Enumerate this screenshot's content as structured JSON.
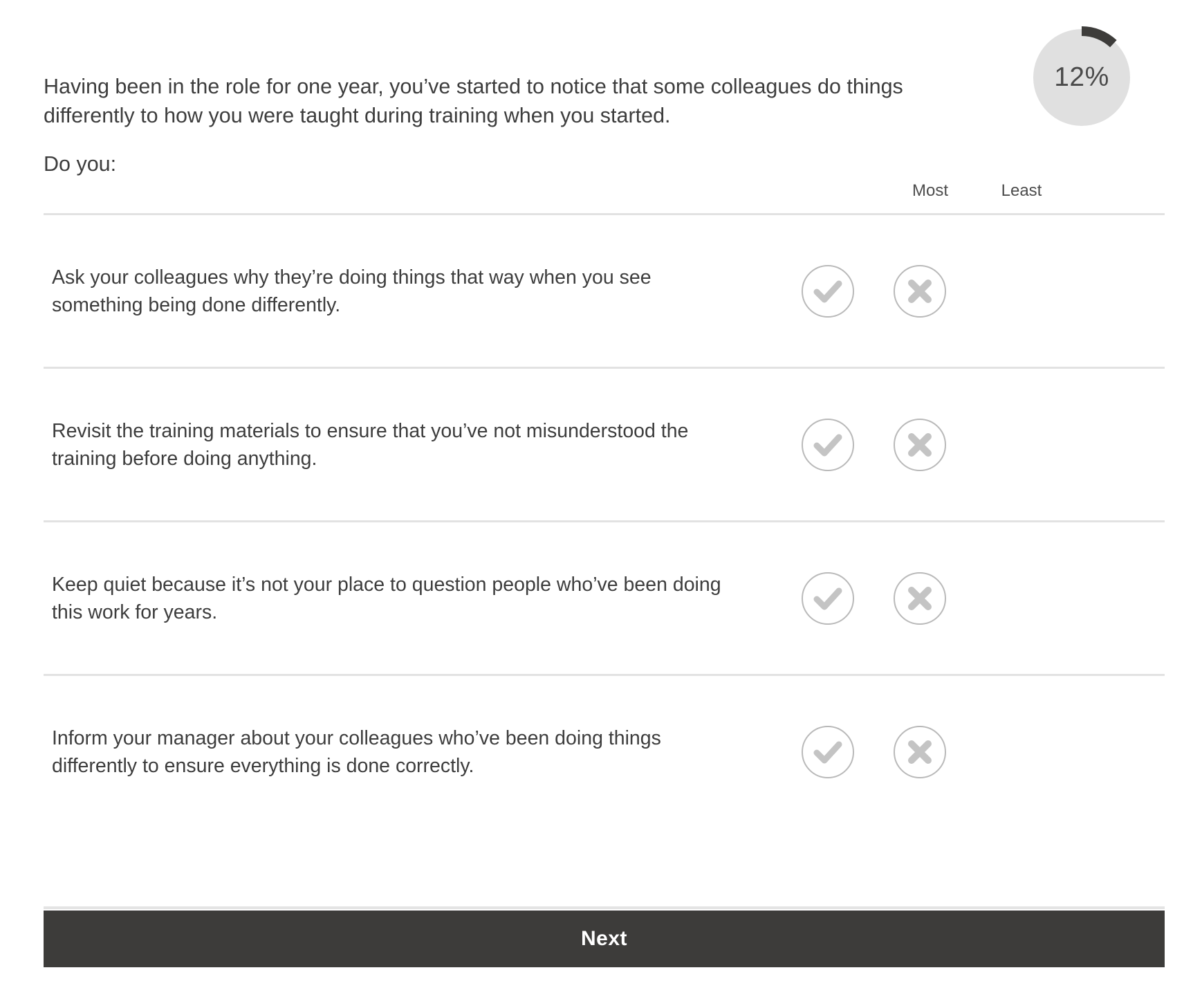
{
  "progress": {
    "percent_label": "12%",
    "percent_value": 12,
    "track_color": "#e0e0e0",
    "arc_color": "#3d3c3a"
  },
  "question": {
    "stem_line_1": "Having been in the role for one year, you’ve started to notice that some colleagues do things",
    "stem_line_2": "differently to how you were taught during training when you started.",
    "prompt": "Do you:"
  },
  "columns": {
    "most": "Most",
    "least": "Least"
  },
  "options": [
    {
      "line_1": "Ask your colleagues why they’re doing things that way when you see",
      "line_2": "something being done differently."
    },
    {
      "line_1": "Revisit the training materials to ensure that you’ve not misunderstood the",
      "line_2": "training before doing anything."
    },
    {
      "line_1": "Keep quiet because it’s not your place to question people who’ve been doing",
      "line_2": "this work for years."
    },
    {
      "line_1": "Inform your manager about your colleagues who’ve been doing things",
      "line_2": "differently to ensure everything is done correctly."
    }
  ],
  "footer": {
    "next_label": "Next",
    "button_color": "#3d3c3a"
  },
  "icons": {
    "check": "check-icon",
    "cross": "cross-icon"
  }
}
